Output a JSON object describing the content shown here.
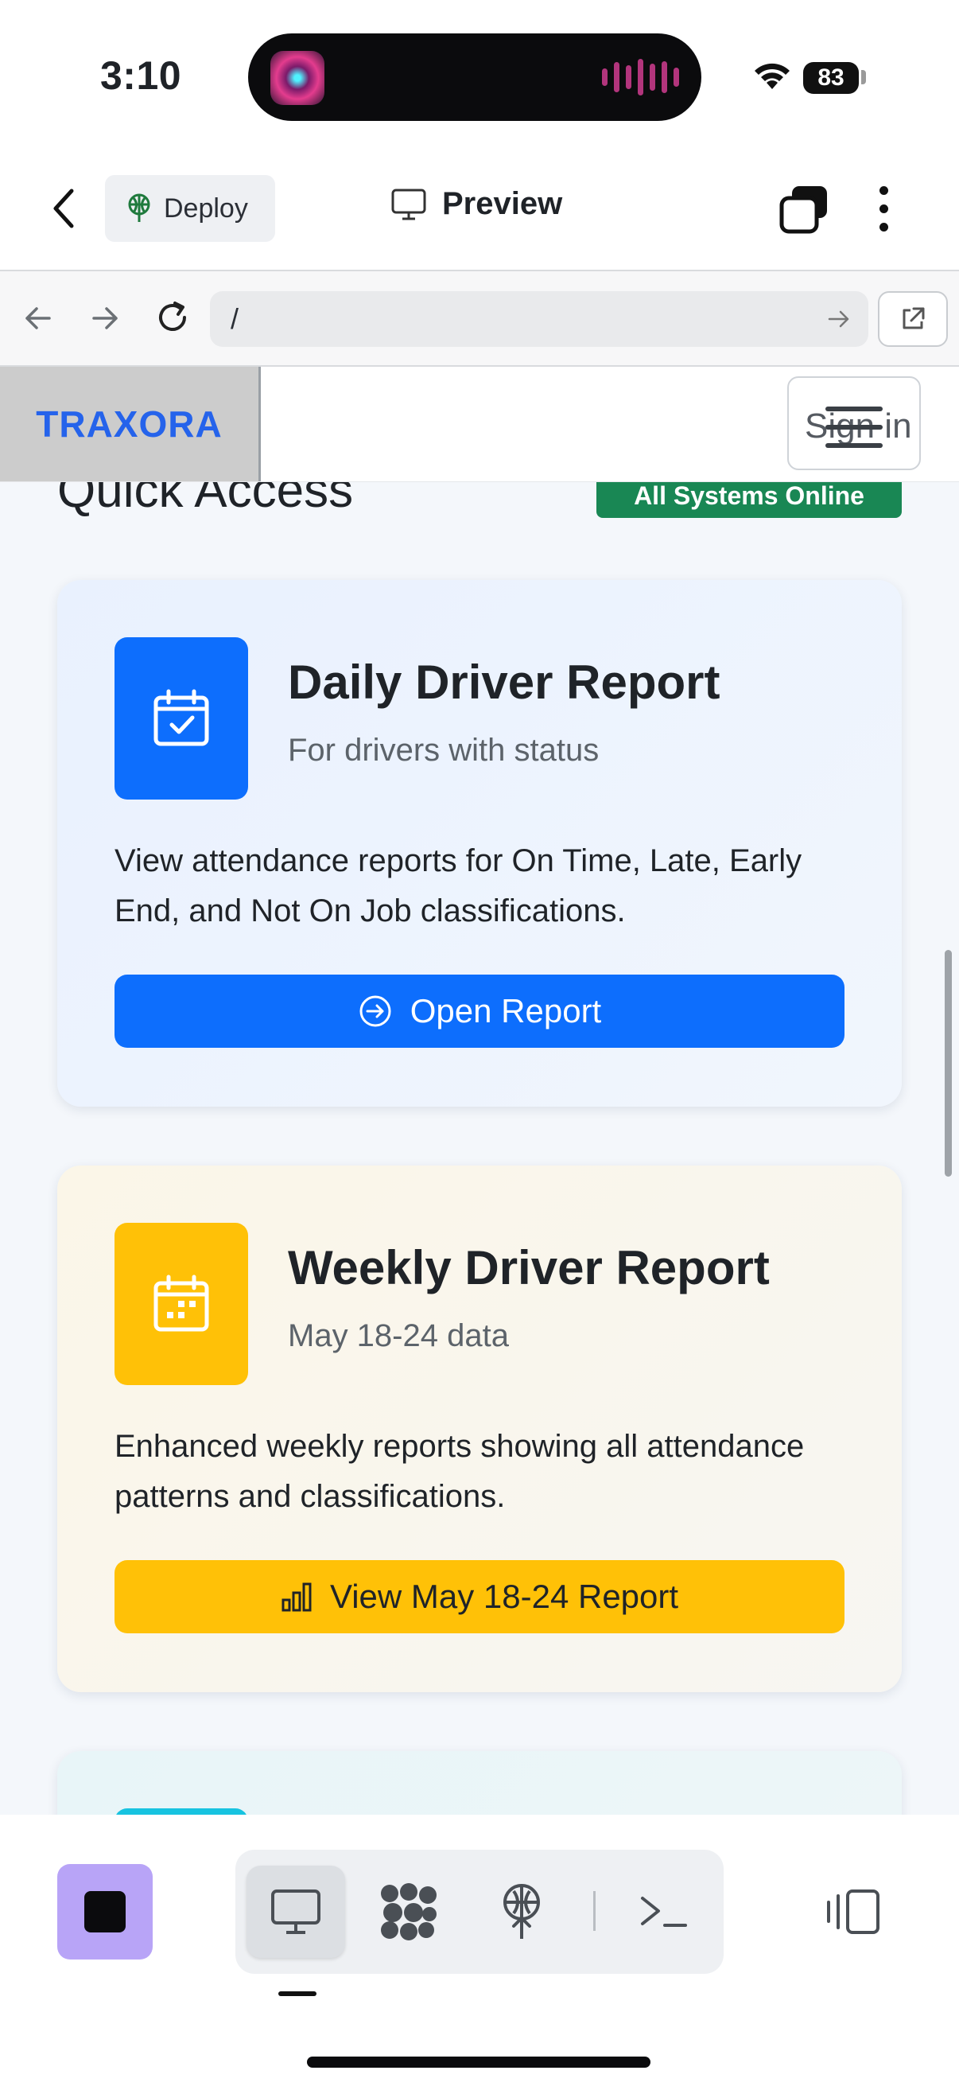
{
  "status_bar": {
    "time": "3:10",
    "battery": "83"
  },
  "header": {
    "deploy_label": "Deploy",
    "title": "Preview"
  },
  "url_bar": {
    "url": "/"
  },
  "site": {
    "logo": "TRAXORA",
    "sign_in": "Sign in",
    "section_title": "Quick Access",
    "status_badge": "All Systems Online"
  },
  "cards": [
    {
      "title": "Daily Driver Report",
      "subtitle": "For drivers with status",
      "description": "View attendance reports for On Time, Late, Early End, and Not On Job classifications.",
      "button": "Open Report",
      "icon": "calendar-check-icon",
      "color": "#0d6efd"
    },
    {
      "title": "Weekly Driver Report",
      "subtitle": "May 18-24 data",
      "description": "Enhanced weekly reports showing all attendance patterns and classifications.",
      "button": "View May 18-24 Report",
      "icon": "calendar-week-icon",
      "color": "#ffc107"
    }
  ],
  "toolbar": {
    "items": [
      "preview-icon",
      "agents-icon",
      "deploy-icon",
      "shell-icon"
    ],
    "accent": "#b8a4f7"
  }
}
